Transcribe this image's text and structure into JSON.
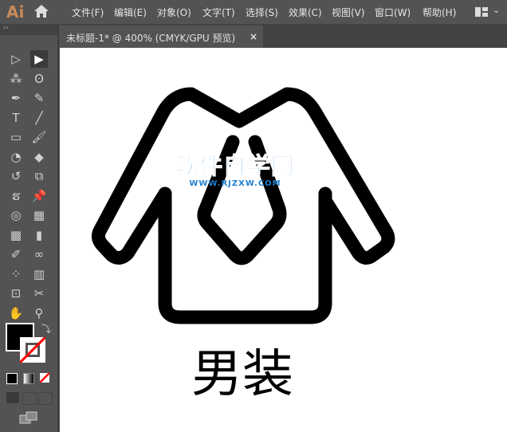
{
  "app": {
    "logo": "Ai"
  },
  "menu": [
    "文件(F)",
    "编辑(E)",
    "对象(O)",
    "文字(T)",
    "选择(S)",
    "效果(C)",
    "视图(V)",
    "窗口(W)",
    "帮助(H)"
  ],
  "tab": {
    "title": "未标题-1* @ 400% (CMYK/GPU 预览)",
    "close": "×"
  },
  "toolbar": {
    "collapse": "‹‹"
  },
  "tools": [
    "selection",
    "direct-selection",
    "magic-wand",
    "lasso",
    "pen",
    "curvature",
    "type",
    "line",
    "rectangle",
    "paintbrush",
    "shaper",
    "eraser",
    "rotate",
    "scale",
    "warp",
    "pin",
    "shape-builder",
    "perspective-grid",
    "mesh",
    "gradient",
    "eyedropper",
    "blend",
    "symbol-sprayer",
    "column-graph",
    "artboard",
    "slice",
    "hand",
    "zoom"
  ],
  "canvas": {
    "caption": "男装",
    "watermark": {
      "title": "软件自学网",
      "url": "WWW.RJZXW.COM"
    }
  },
  "colors": {
    "accent": "#1e7fd0",
    "panel": "#535353"
  }
}
